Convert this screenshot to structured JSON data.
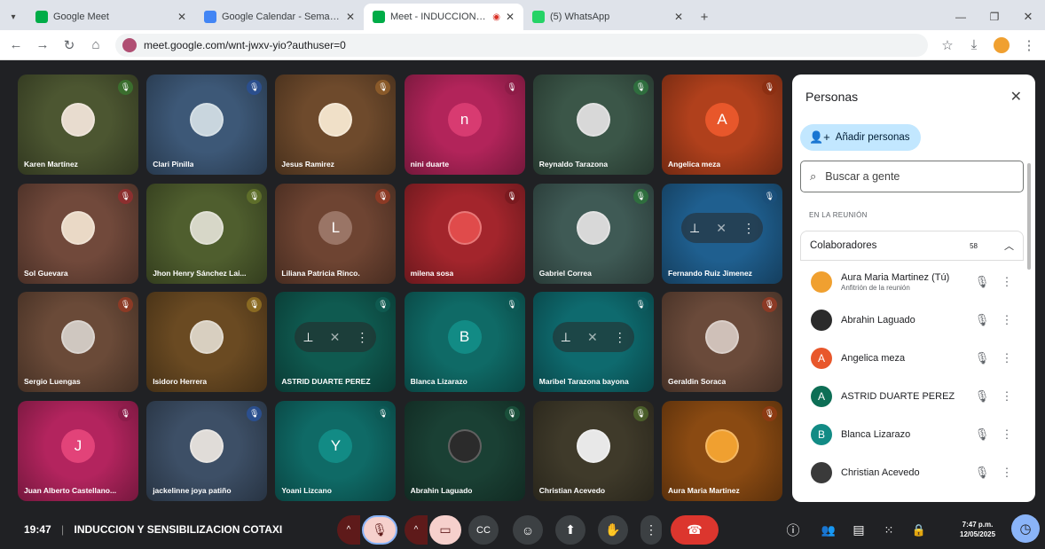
{
  "browser": {
    "tabs": [
      {
        "title": "Google Meet",
        "favicon_color": "#00ac47"
      },
      {
        "title": "Google Calendar - Semana del",
        "favicon_color": "#4285f4"
      },
      {
        "title": "Meet - INDUCCION Y SENS",
        "favicon_color": "#00ac47",
        "active": true
      },
      {
        "title": "(5) WhatsApp",
        "favicon_color": "#25d366"
      }
    ],
    "url": "meet.google.com/wnt-jwxv-yio?authuser=0"
  },
  "tiles": [
    {
      "name": "Karen Martínez",
      "bg": "#4c5631",
      "mic": "#3b6e2e",
      "avatar_type": "photo",
      "avatar_color": "#e8dccf"
    },
    {
      "name": "Clari Pinilla",
      "bg": "#3d5877",
      "mic": "#2b4f8e",
      "avatar_type": "photo",
      "avatar_color": "#c9d6de"
    },
    {
      "name": "Jesus Ramirez",
      "bg": "#6e4a2c",
      "mic": "#8a5a2a",
      "avatar_type": "photo",
      "avatar_color": "#f0e0c8"
    },
    {
      "name": "nini duarte",
      "bg": "#b2245a",
      "mic": "#8e1c47",
      "avatar_type": "letter",
      "letter": "n",
      "avatar_color": "#d83b71"
    },
    {
      "name": "Reynaldo Tarazona",
      "bg": "#3b5648",
      "mic": "#2f6e3e",
      "avatar_type": "photo",
      "avatar_color": "#d8d8d8"
    },
    {
      "name": "Angelica meza",
      "bg": "#b0401c",
      "mic": "#8c2f12",
      "avatar_type": "letter",
      "letter": "A",
      "avatar_color": "#e8572b"
    },
    {
      "name": "Sol Guevara",
      "bg": "#71493b",
      "mic": "#8c2f2f",
      "avatar_type": "photo",
      "avatar_color": "#ead9c6"
    },
    {
      "name": "Jhon Henry Sánchez Lai...",
      "bg": "#4f5e2e",
      "mic": "#5e6e2a",
      "avatar_type": "photo",
      "avatar_color": "#d7d7c8"
    },
    {
      "name": "Liliana Patricia Rinco.",
      "bg": "#6e4432",
      "mic": "#8c3a25",
      "avatar_type": "letter",
      "letter": "L",
      "avatar_color": "#9a7566"
    },
    {
      "name": "milena sosa",
      "bg": "#a3252c",
      "mic": "#7a1a1f",
      "avatar_type": "photo",
      "avatar_color": "#e04b4b"
    },
    {
      "name": "Gabriel Correa",
      "bg": "#3f5a55",
      "mic": "#2f6e3e",
      "avatar_type": "photo",
      "avatar_color": "#d8d8d8"
    },
    {
      "name": "Fernando Ruiz Jimenez",
      "bg": "#1f5f8f",
      "mic": "#1a4f7a",
      "avatar_type": "pill"
    },
    {
      "name": "Sergio Luengas",
      "bg": "#6a4a38",
      "mic": "#8c3a25",
      "avatar_type": "photo",
      "avatar_color": "#cfc7c0"
    },
    {
      "name": "Isidoro Herrera",
      "bg": "#6a4a22",
      "mic": "#8a6a22",
      "avatar_type": "photo",
      "avatar_color": "#d8cfc0"
    },
    {
      "name": "ASTRID DUARTE PEREZ",
      "bg": "#0f5a50",
      "mic": "#0f5a50",
      "avatar_type": "pill"
    },
    {
      "name": "Blanca Lizarazo",
      "bg": "#0f6a66",
      "mic": "#0d5a56",
      "avatar_type": "letter",
      "letter": "B",
      "avatar_color": "#128b85"
    },
    {
      "name": "Maribel Tarazona bayona",
      "bg": "#0e6a6e",
      "mic": "#0d5a5e",
      "avatar_type": "pill"
    },
    {
      "name": "Geraldin Soraca",
      "bg": "#6a4a3a",
      "mic": "#8c3a25",
      "avatar_type": "photo",
      "avatar_color": "#cfc0b8"
    },
    {
      "name": "Juan Alberto Castellano...",
      "bg": "#b3245e",
      "mic": "#8c1c4a",
      "avatar_type": "letter",
      "letter": "J",
      "avatar_color": "#e24379"
    },
    {
      "name": "jackelinne joya patiño",
      "bg": "#3d4f66",
      "mic": "#2b4f8e",
      "avatar_type": "photo",
      "avatar_color": "#e0dcd8"
    },
    {
      "name": "Yoani Lizcano",
      "bg": "#0f6a66",
      "mic": "#0d5a56",
      "avatar_type": "letter",
      "letter": "Y",
      "avatar_color": "#128b85"
    },
    {
      "name": "Abrahin Laguado",
      "bg": "#1a4034",
      "mic": "#1a4f3a",
      "avatar_type": "photo",
      "avatar_color": "#2b2b2b"
    },
    {
      "name": "Christian Acevedo",
      "bg": "#3f3a2a",
      "mic": "#4a5e2a",
      "avatar_type": "photo",
      "avatar_color": "#e8e8e8"
    },
    {
      "name": "Aura Maria Martinez",
      "bg": "#8a4a12",
      "mic": "#8c3a12",
      "avatar_type": "photo",
      "avatar_color": "#f0a030"
    }
  ],
  "people_panel": {
    "title": "Personas",
    "add_label": "Añadir personas",
    "search_placeholder": "Buscar a gente",
    "section_label": "EN LA REUNIÓN",
    "group_label": "Colaboradores",
    "group_count": "58",
    "people": [
      {
        "name": "Aura Maria Martinez (Tú)",
        "subtitle": "Anfitrión de la reunión",
        "avatar_color": "#f0a030",
        "letter": ""
      },
      {
        "name": "Abrahin Laguado",
        "subtitle": "",
        "avatar_color": "#2b2b2b",
        "letter": ""
      },
      {
        "name": "Angelica meza",
        "subtitle": "",
        "avatar_color": "#e8572b",
        "letter": "A"
      },
      {
        "name": "ASTRID DUARTE PEREZ",
        "subtitle": "",
        "avatar_color": "#0d6e55",
        "letter": "A"
      },
      {
        "name": "Blanca Lizarazo",
        "subtitle": "",
        "avatar_color": "#128b85",
        "letter": "B"
      },
      {
        "name": "Christian Acevedo",
        "subtitle": "",
        "avatar_color": "#3a3a3a",
        "letter": ""
      }
    ]
  },
  "bottom_bar": {
    "time": "19:47",
    "meeting_title": "INDUCCION Y SENSIBILIZACION COTAXI",
    "clock_time": "7:47 p.m.",
    "clock_date": "12/05/2025"
  },
  "colors": {
    "end_call": "#dc362e",
    "muted_bg": "#5e1a1a",
    "control_bg": "#3c4043",
    "add_button_bg": "#c2e7ff"
  }
}
